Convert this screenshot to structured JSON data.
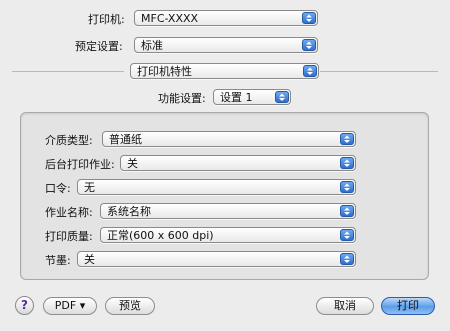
{
  "printer": {
    "label": "打印机:",
    "value": "MFC-XXXX"
  },
  "preset": {
    "label": "预定设置:",
    "value": "标准"
  },
  "section_popup": {
    "value": "打印机特性"
  },
  "feature_set": {
    "label": "功能设置:",
    "value": "设置 1"
  },
  "settings": [
    {
      "label": "介质类型:",
      "value": "普通纸"
    },
    {
      "label": "后台打印作业:",
      "value": "关"
    },
    {
      "label": "口令:",
      "value": "无"
    },
    {
      "label": "作业名称:",
      "value": "系统名称"
    },
    {
      "label": "打印质量:",
      "value": "正常(600 x 600 dpi)"
    },
    {
      "label": "节墨:",
      "value": "关"
    }
  ],
  "footer": {
    "help": "?",
    "pdf": "PDF ▾",
    "preview": "预览",
    "cancel": "取消",
    "print": "打印"
  },
  "colors": {
    "accent": "#3a7be0",
    "background": "#ececec"
  }
}
